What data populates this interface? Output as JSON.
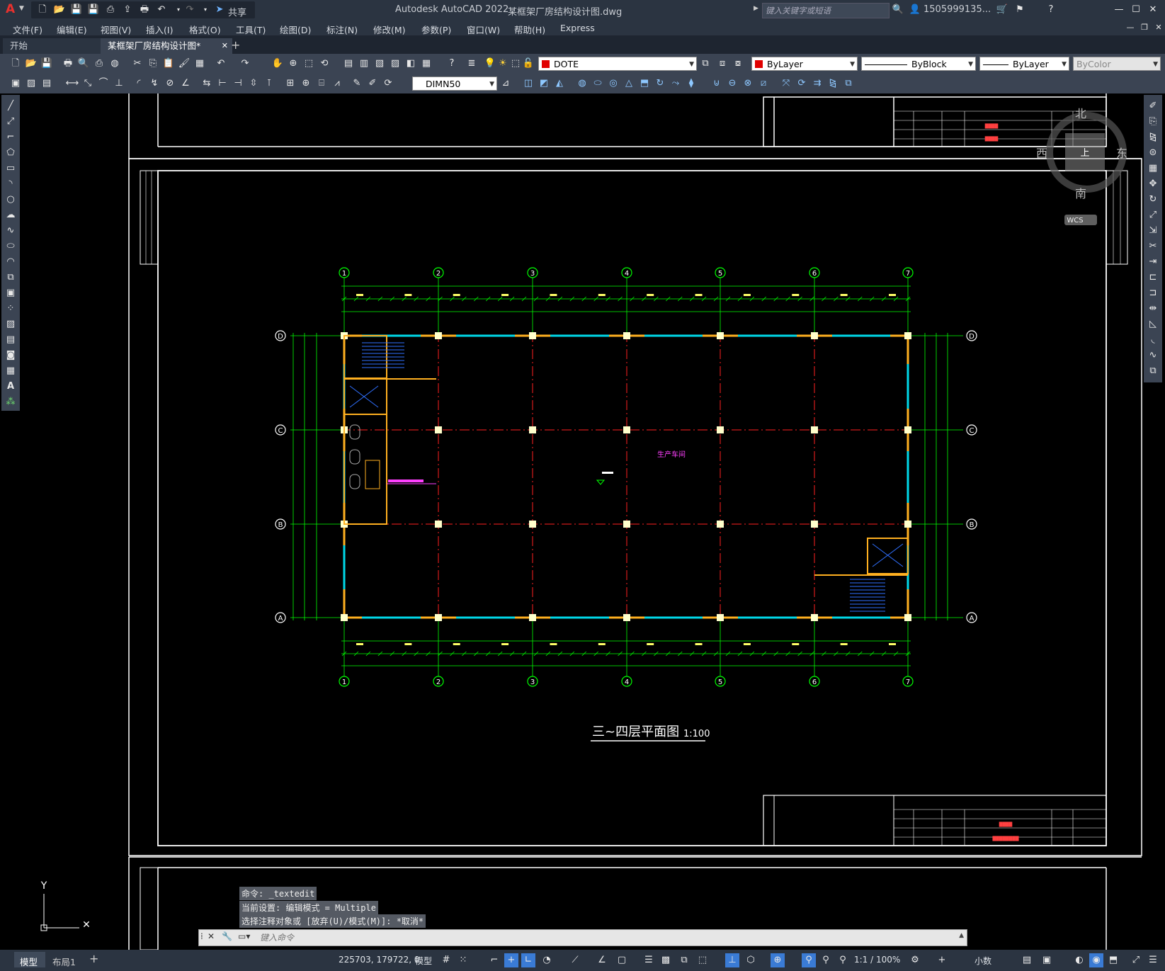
{
  "window": {
    "app_title": "Autodesk AutoCAD 2022",
    "file_title": "某框架厂房结构设计图.dwg",
    "share_label": "共享",
    "search_placeholder": "键入关键字或短语",
    "user": "1505999135..."
  },
  "menu": [
    "文件(F)",
    "编辑(E)",
    "视图(V)",
    "插入(I)",
    "格式(O)",
    "工具(T)",
    "绘图(D)",
    "标注(N)",
    "修改(M)",
    "参数(P)",
    "窗口(W)",
    "帮助(H)",
    "Express"
  ],
  "tabs": {
    "start": "开始",
    "active": "某框架厂房结构设计图*"
  },
  "properties": {
    "layer": "DOTE",
    "color": "ByLayer",
    "linetype": "ByBlock",
    "lineweight": "ByLayer",
    "plotstyle": "ByColor",
    "dimstyle": "DIMN50",
    "layer_color": "#e00000"
  },
  "viewcube": {
    "north": "北",
    "south": "南",
    "west": "西",
    "east": "东",
    "top": "上",
    "wcs": "WCS"
  },
  "drawing": {
    "title": "三~四层平面图",
    "scale": "1:100",
    "room_label": "生产车间",
    "grid_columns": [
      "1",
      "2",
      "3",
      "4",
      "5",
      "6",
      "7"
    ],
    "grid_rows": [
      "D",
      "C",
      "B",
      "A"
    ],
    "axis_y": "Y"
  },
  "command": {
    "history": [
      "命令: _textedit",
      "当前设置: 编辑模式 = Multiple",
      "选择注释对象或 [放弃(U)/模式(M)]: *取消*"
    ],
    "placeholder": "键入命令"
  },
  "layout_tabs": {
    "model": "模型",
    "layout1": "布局1"
  },
  "status": {
    "coords": "225703, 179722, 0",
    "model": "模型",
    "scale": "1:1 / 100%",
    "units": "小数"
  }
}
